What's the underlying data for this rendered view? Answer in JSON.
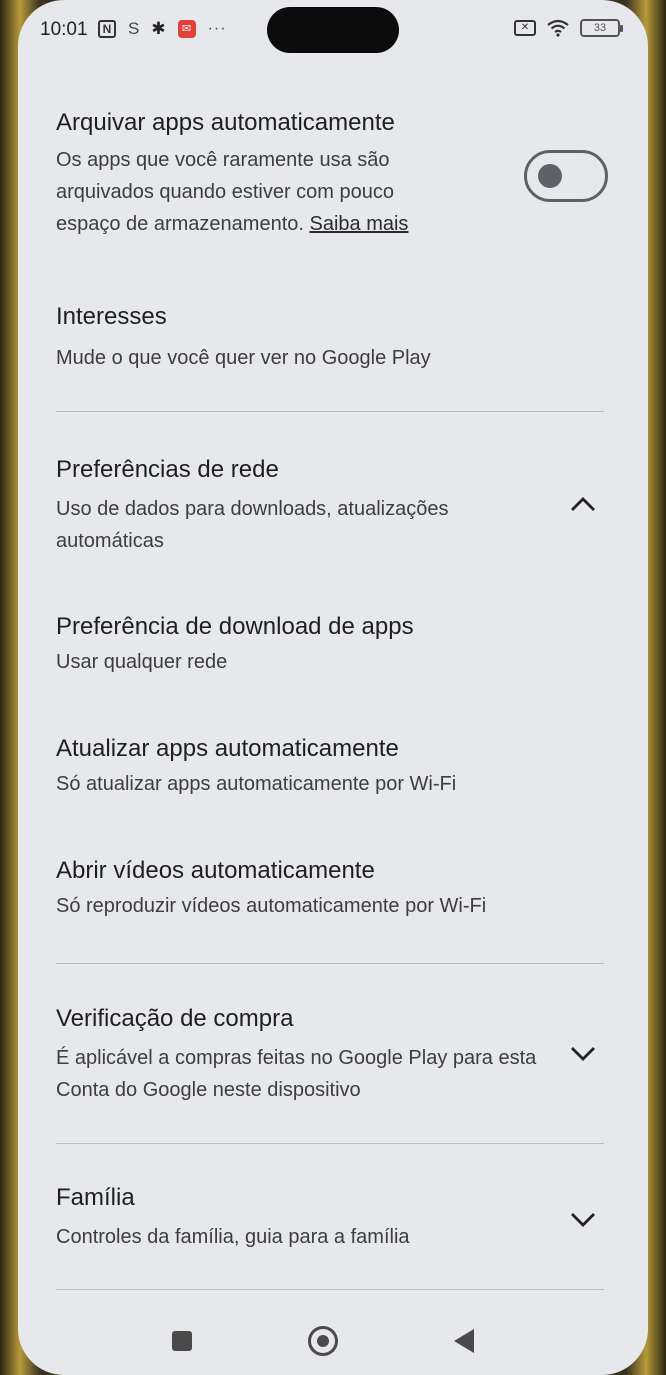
{
  "status_bar": {
    "time": "10:01",
    "battery_level": "33",
    "icons_left": [
      "nfc-icon",
      "s-icon",
      "gear-icon",
      "mail-icon",
      "more-dots-icon"
    ],
    "icons_right": [
      "sim-off-icon",
      "wifi-icon",
      "battery-icon"
    ]
  },
  "settings": {
    "archive": {
      "title": "Arquivar apps automaticamente",
      "description": "Os apps que você raramente usa são arquivados quando estiver com pouco espaço de armazenamento.",
      "link": "Saiba mais",
      "toggle_on": false
    },
    "interests": {
      "title": "Interesses",
      "description": "Mude o que você quer ver no Google Play"
    },
    "network": {
      "title": "Preferências de rede",
      "description": "Uso de dados para downloads, atualizações automáticas",
      "expanded": true
    },
    "download_pref": {
      "title": "Preferência de download de apps",
      "description": "Usar qualquer rede"
    },
    "auto_update": {
      "title": "Atualizar apps automaticamente",
      "description": "Só atualizar apps automaticamente por Wi-Fi"
    },
    "autoplay": {
      "title": "Abrir vídeos automaticamente",
      "description": "Só reproduzir vídeos automaticamente por Wi-Fi"
    },
    "purchase": {
      "title": "Verificação de compra",
      "description": "É aplicável a compras feitas no Google Play para esta Conta do Google neste dispositivo",
      "expanded": false
    },
    "family": {
      "title": "Família",
      "description": "Controles da família, guia para a família",
      "expanded": false
    }
  },
  "colors": {
    "background": "#e6e8ec",
    "text_primary": "#1f1f1f",
    "text_secondary": "#3d3d3d",
    "toggle_off": "#5f6166"
  }
}
